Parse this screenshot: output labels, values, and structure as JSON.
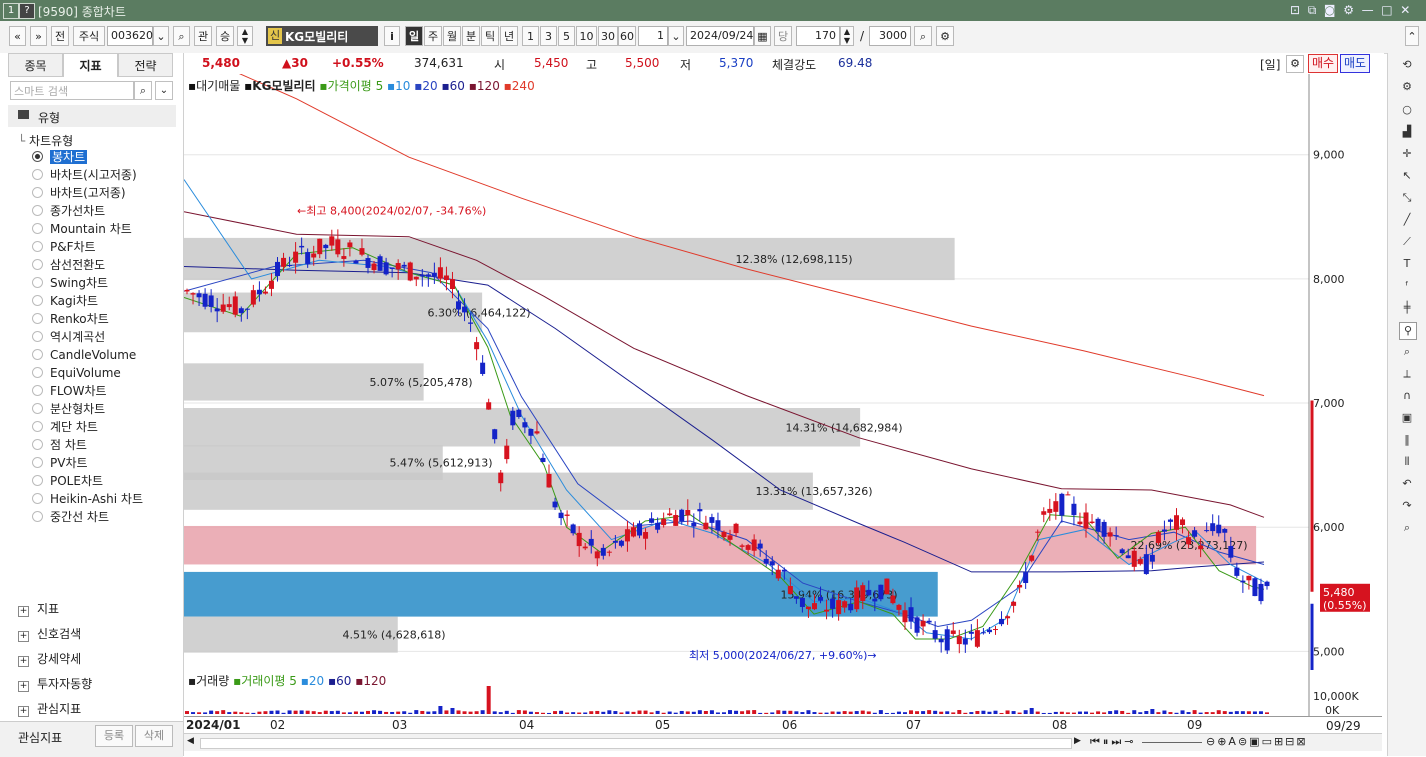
{
  "window": {
    "title": "[9590] 종합차트",
    "badges": [
      "1",
      "?"
    ]
  },
  "toolbar": {
    "nav_prev": "«",
    "nav_dropdown": "»",
    "jeon": "전",
    "market": "주식",
    "code": "003620",
    "gwan": "관",
    "seung": "승",
    "credit_badge": "신",
    "stock_name": "KG모빌리티",
    "info": "i",
    "periods": [
      "일",
      "주",
      "월",
      "분",
      "틱",
      "년"
    ],
    "intervals": [
      "1",
      "3",
      "5",
      "10",
      "30",
      "60"
    ],
    "interval_value": "1",
    "date": "2024/09/24",
    "dang": "당",
    "count": "170",
    "slash": "/",
    "total": "3000"
  },
  "left_panel": {
    "tabs": [
      "종목",
      "지표",
      "전략"
    ],
    "search_placeholder": "스마트 검색",
    "tree_root": "유형",
    "tree_sub": "차트유형",
    "chart_types": [
      "봉차트",
      "바차트(시고저종)",
      "바차트(고저종)",
      "종가선차트",
      "Mountain 차트",
      "P&F차트",
      "삼선전환도",
      "Swing차트",
      "Kagi차트",
      "Renko차트",
      "역시계곡선",
      "CandleVolume",
      "EquiVolume",
      "FLOW차트",
      "분산형차트",
      "계단 차트",
      "점 차트",
      "PV차트",
      "POLE차트",
      "Heikin-Ashi 차트",
      "중간선 차트"
    ],
    "selected_type": "봉차트",
    "sections": [
      "지표",
      "신호검색",
      "강세약세",
      "투자자동향",
      "관심지표"
    ],
    "bottom_label": "관심지표",
    "register": "등록",
    "delete": "삭제"
  },
  "info_bar": {
    "price": "5,480",
    "change": "▲30",
    "change_pct": "+0.55%",
    "volume": "374,631",
    "open_label": "시",
    "open": "5,450",
    "high_label": "고",
    "high": "5,500",
    "low_label": "저",
    "low": "5,370",
    "strength_label": "체결강도",
    "strength": "69.48",
    "period_label": "[일]",
    "buy": "매수",
    "sell": "매도"
  },
  "legend": {
    "main": "대기매물",
    "stock": "KG모빌리티",
    "ma_label": "가격이평",
    "ma5": "5",
    "ma10": "10",
    "ma20": "20",
    "ma60": "60",
    "ma120": "120",
    "ma240": "240",
    "vol": "거래량",
    "vol_ma": "거래이평",
    "vol_ma5": "5",
    "vol_ma20": "20",
    "vol_ma60": "60",
    "vol_ma120": "120"
  },
  "colors": {
    "up": "#d6131f",
    "down": "#1423c8",
    "ma5": "#3a9a17",
    "ma10": "#2a8cdc",
    "ma20": "#2a45c2",
    "ma60": "#1b1f8f",
    "ma120": "#7a1530",
    "ma240": "#e03a2a",
    "grey_band": "#c9c9c9",
    "pink_band": "#e8a1aa",
    "blue_band": "#3d97cc"
  },
  "annotations": {
    "high": "←최고 8,400(2024/02/07, -34.76%)",
    "low": "최저 5,000(2024/06/27, +9.60%)→"
  },
  "volume_profile": [
    {
      "label": "12.38% (12,698,115)"
    },
    {
      "label": "6.30% (6,464,122)"
    },
    {
      "label": "5.07% (5,205,478)"
    },
    {
      "label": "14.31% (14,682,984)"
    },
    {
      "label": "5.47% (5,612,913)"
    },
    {
      "label": "13.31% (13,657,326)"
    },
    {
      "label": "22.69% (23,273,127)"
    },
    {
      "label": "15.94% (16,349,673)"
    },
    {
      "label": "4.51% (4,628,618)"
    }
  ],
  "price_axis": {
    "ticks": [
      "9,000",
      "8,000",
      "7,000",
      "6,000",
      "5,000"
    ],
    "current": "5,480",
    "current_pct": "(0.55%)"
  },
  "volume_axis": {
    "ticks": [
      "10,000K",
      "0K"
    ]
  },
  "x_axis": {
    "labels": [
      "2024/01",
      "02",
      "03",
      "04",
      "05",
      "06",
      "07",
      "08",
      "09"
    ],
    "last": "09/29"
  },
  "chart_data": {
    "type": "candlestick",
    "title": "KG모빌리티",
    "x_range": [
      "2024/01",
      "2024/09/24"
    ],
    "y_ticks": [
      5000,
      6000,
      7000,
      8000,
      9000
    ],
    "ylim": [
      4850,
      9650
    ],
    "series": [
      {
        "name": "가격이평 5"
      },
      {
        "name": "10"
      },
      {
        "name": "20"
      },
      {
        "name": "60"
      },
      {
        "name": "120"
      },
      {
        "name": "240"
      }
    ],
    "last": {
      "date": "2024/09/24",
      "open": 5450,
      "high": 5500,
      "low": 5370,
      "close": 5480,
      "volume": 374631
    },
    "high_point": {
      "date": "2024/02/07",
      "value": 8400
    },
    "low_point": {
      "date": "2024/06/27",
      "value": 5000
    },
    "price_volume_profile_pct": [
      12.38,
      6.3,
      5.07,
      14.31,
      5.47,
      13.31,
      22.69,
      15.94,
      4.51
    ],
    "price_volume_profile_qty": [
      12698115,
      6464122,
      5205478,
      14682984,
      5612913,
      13657326,
      23273127,
      16349673,
      4628618
    ]
  }
}
